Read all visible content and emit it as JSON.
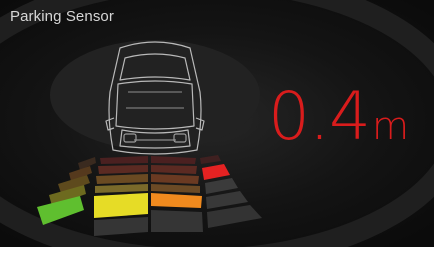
{
  "header": {
    "title": "Parking Sensor"
  },
  "reading": {
    "value": "0.4",
    "unit": "m"
  },
  "sensor_zones": {
    "columns": [
      "far-left",
      "center-left",
      "center-right",
      "far-right"
    ],
    "levels_per_column": 5,
    "active_levels": [
      1,
      2,
      2,
      4
    ],
    "colors": {
      "level_1": "#5fbf2f",
      "level_2": "#e6dc26",
      "level_2_right": "#f08a1e",
      "level_4": "#e52222",
      "inactive": "#3a3a3a"
    }
  },
  "colors": {
    "accent": "#d91c1c",
    "background": "#141414"
  }
}
